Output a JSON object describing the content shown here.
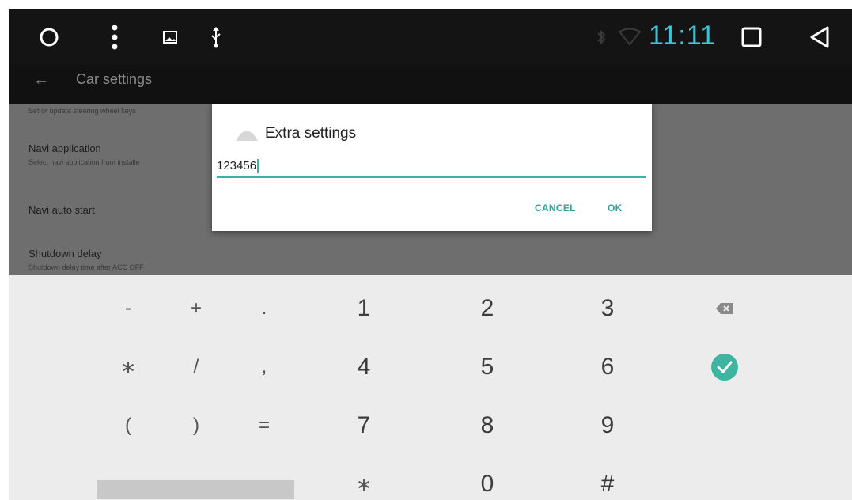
{
  "status_bar": {
    "time": "11:11",
    "icons": [
      "circle-home-icon",
      "menu-dots-icon",
      "image-icon",
      "usb-icon",
      "bluetooth-icon",
      "wifi-icon",
      "square-recents-icon",
      "triangle-back-icon"
    ],
    "time_color": "#3bc4d8"
  },
  "action_bar": {
    "back_icon": "←",
    "title": "Car settings"
  },
  "settings": {
    "items": [
      {
        "title": "",
        "subtitle": "Set or update steering wheel keys"
      },
      {
        "title": "Navi application",
        "subtitle": "Select navi application from installe"
      },
      {
        "title": "Navi auto start",
        "subtitle": ""
      },
      {
        "title": "Shutdown delay",
        "subtitle": "Shutdown delay time after ACC OFF"
      }
    ]
  },
  "dialog": {
    "title": "Extra settings",
    "input_value": "123456",
    "cancel_label": "CANCEL",
    "ok_label": "OK",
    "accent": "#36b4a4"
  },
  "keyboard": {
    "rows": [
      [
        "-",
        "+",
        ".",
        "1",
        "2",
        "3",
        "backspace"
      ],
      [
        "∗",
        "/",
        ",",
        "4",
        "5",
        "6",
        "done"
      ],
      [
        "(",
        ")",
        "=",
        "7",
        "8",
        "9",
        ""
      ],
      [
        "space",
        "",
        "",
        "∗",
        "0",
        "#",
        ""
      ]
    ],
    "done_color": "#3db5a0"
  }
}
